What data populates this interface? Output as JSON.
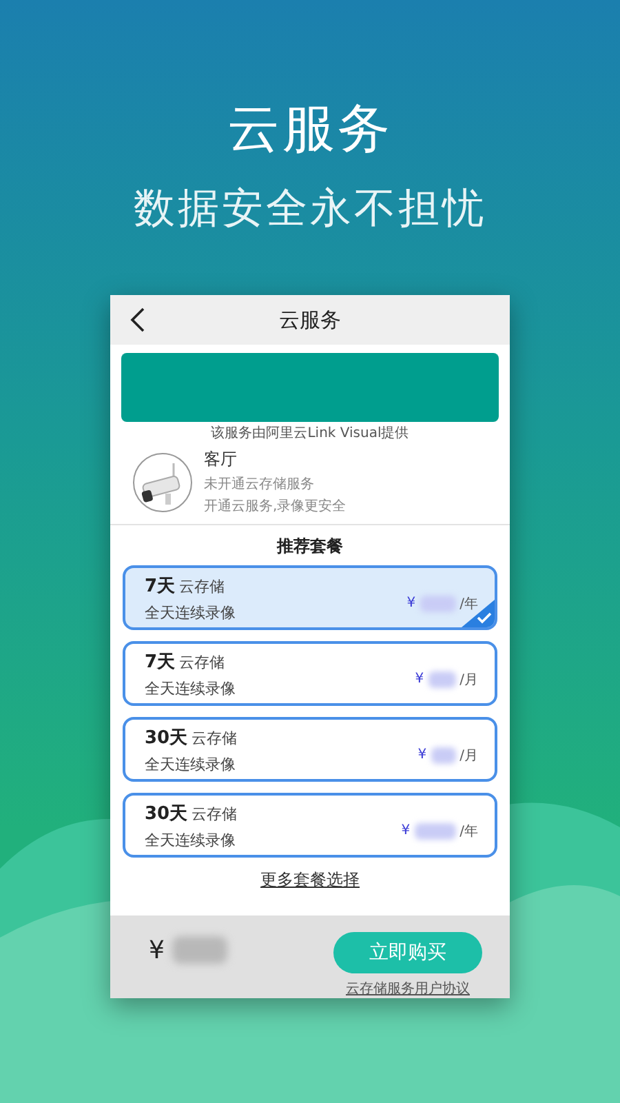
{
  "headline": "云服务",
  "tagline": "数据安全永不担忧",
  "screen": {
    "title": "云服务",
    "provider_note": "该服务由阿里云Link Visual提供",
    "device": {
      "name": "客厅",
      "status": "未开通云存储服务",
      "hint": "开通云服务,录像更安全"
    },
    "section_title": "推荐套餐",
    "plans": [
      {
        "days": "7天",
        "type": "云存储",
        "desc": "全天连续录像",
        "currency": "¥",
        "unit": "/年",
        "selected": true
      },
      {
        "days": "7天",
        "type": "云存储",
        "desc": "全天连续录像",
        "currency": "¥",
        "unit": "/月",
        "selected": false
      },
      {
        "days": "30天",
        "type": "云存储",
        "desc": "全天连续录像",
        "currency": "¥",
        "unit": "/月",
        "selected": false
      },
      {
        "days": "30天",
        "type": "云存储",
        "desc": "全天连续录像",
        "currency": "¥",
        "unit": "/年",
        "selected": false
      }
    ],
    "more_link": "更多套餐选择",
    "footer": {
      "currency": "¥",
      "buy_button": "立即购买",
      "agreement": "云存储服务用户协议"
    }
  }
}
